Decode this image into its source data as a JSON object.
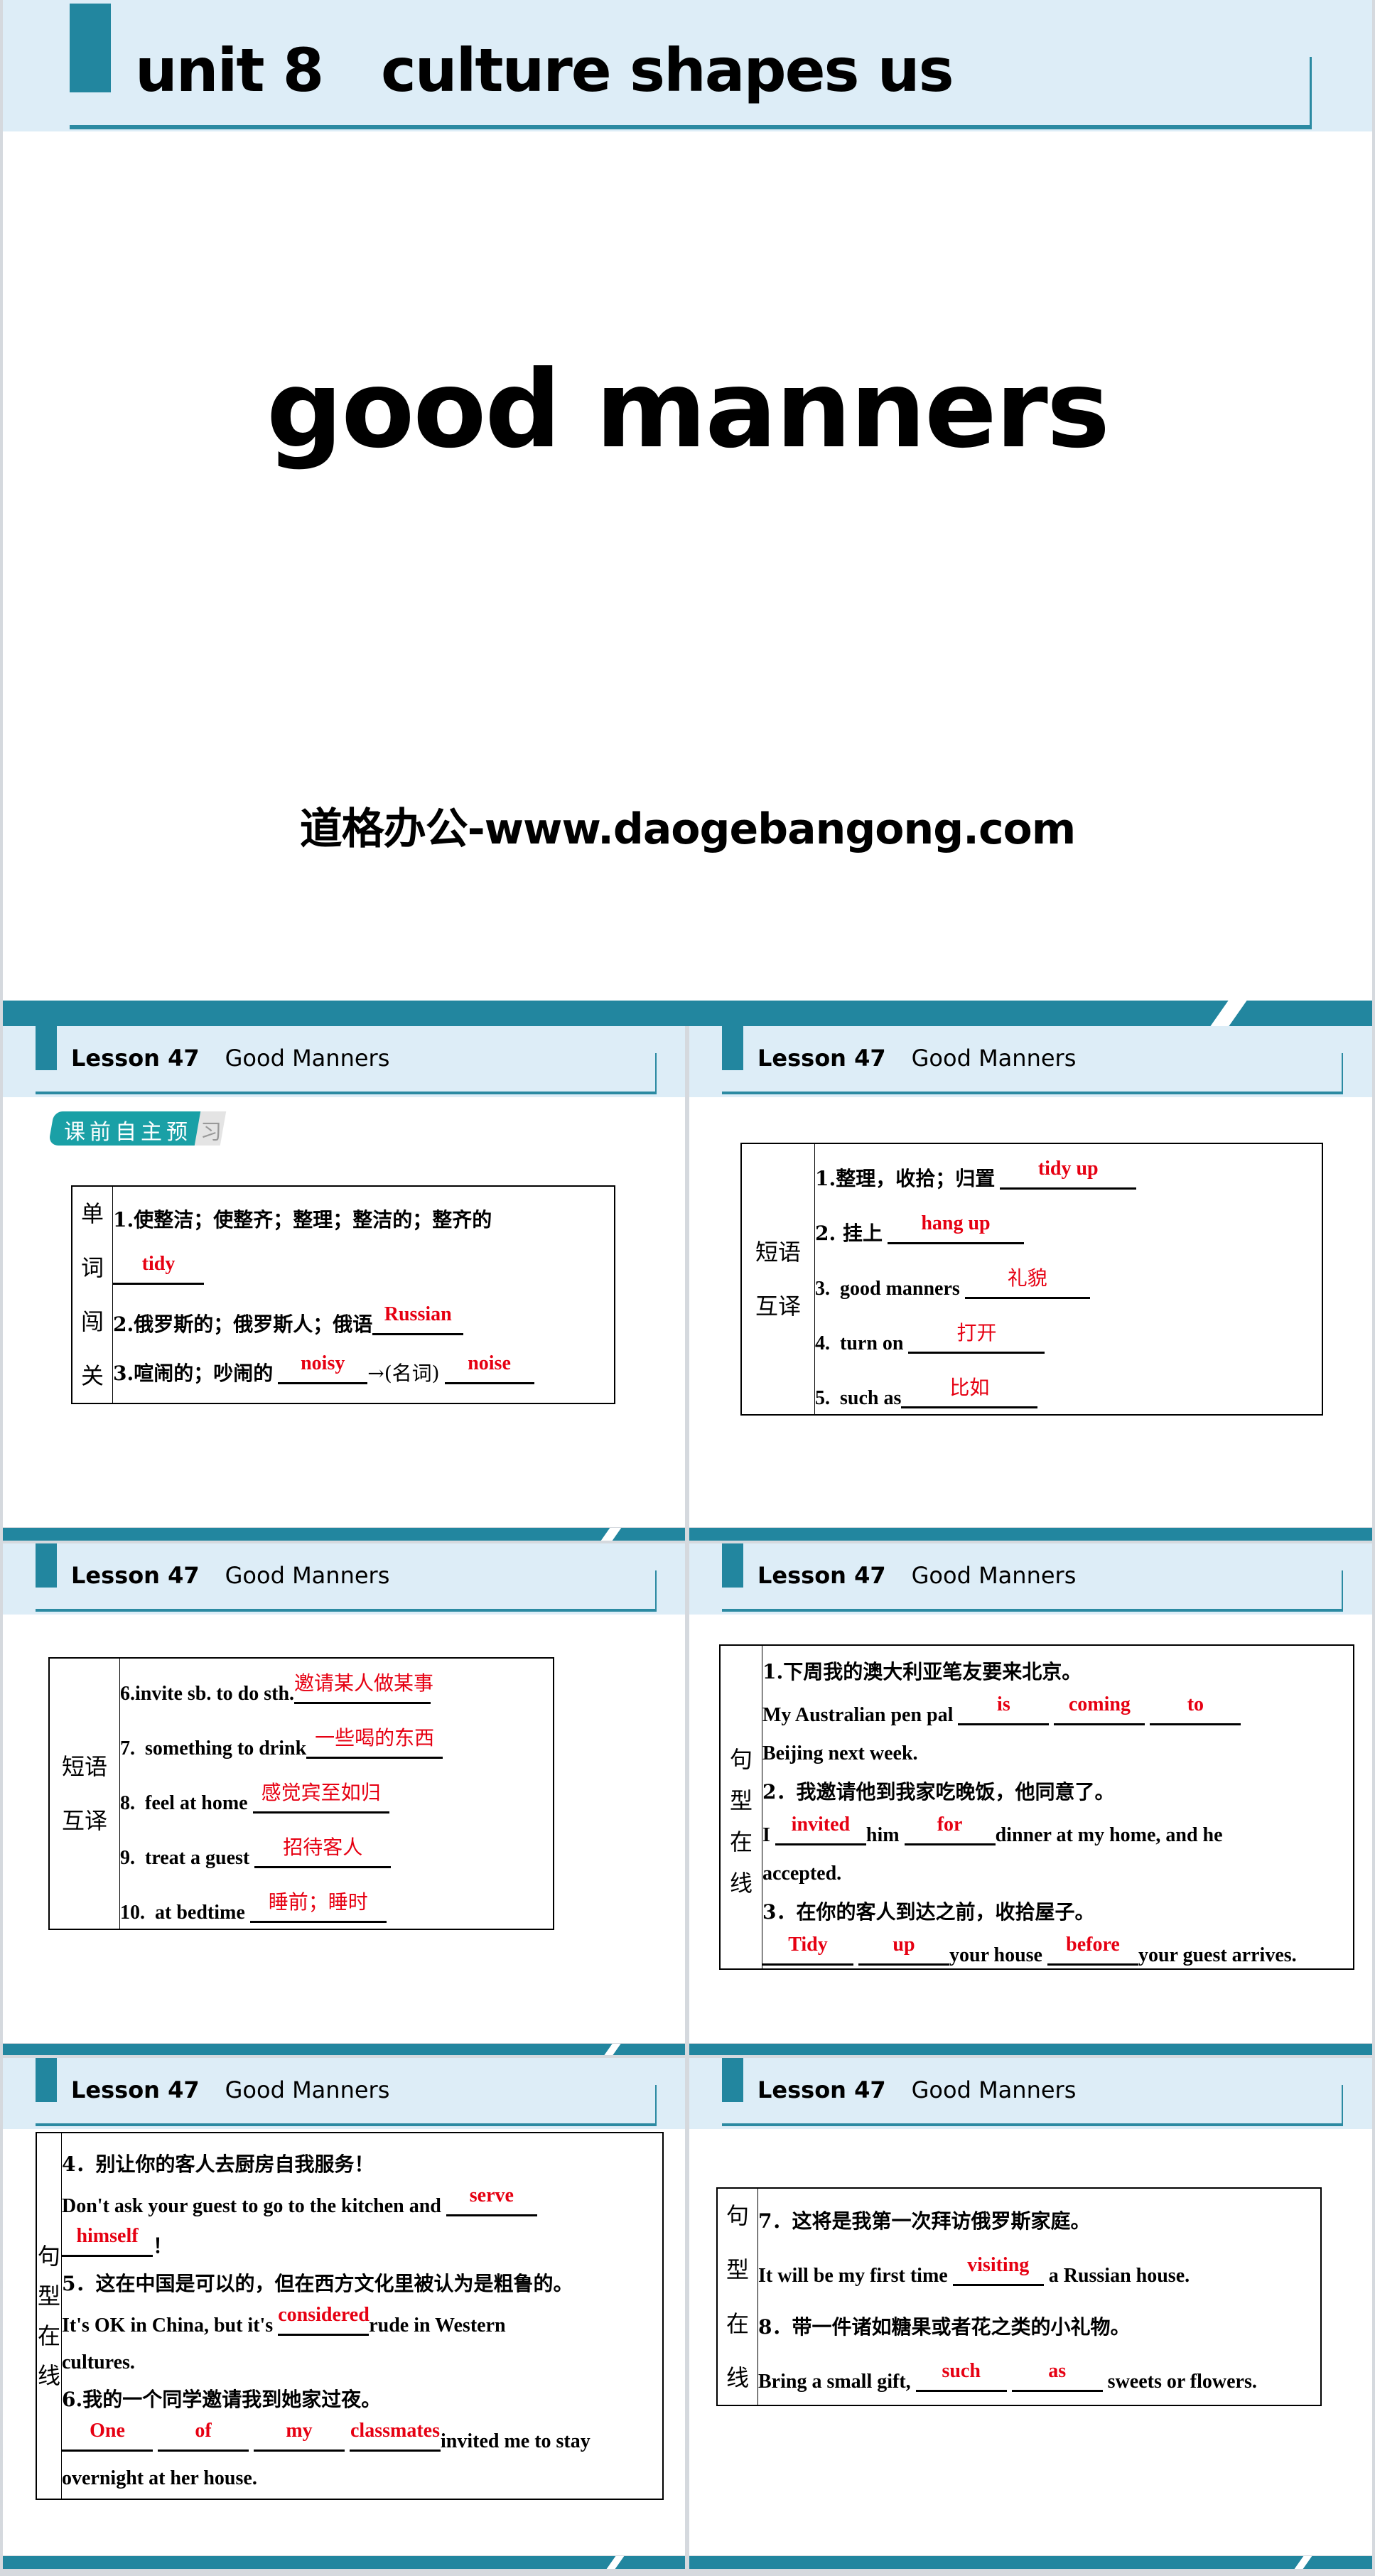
{
  "cover": {
    "unit_title": "unit 8   culture shapes us",
    "main_title": "good manners",
    "website": "道格办公-www.daogebangong.com"
  },
  "lesson_header": {
    "lesson": "Lesson 47",
    "title": "Good Manners"
  },
  "badge": {
    "text": "课前自主预",
    "last_char": "习"
  },
  "colors": {
    "accent": "#22869f",
    "header_band": "#ddedf7",
    "answer": "#e60012"
  },
  "slide2": {
    "side_label": [
      "单",
      "词",
      "闯",
      "关"
    ],
    "items": [
      {
        "prompt": "1.使整洁；使整齐；整理；整洁的；整齐的",
        "answer": "tidy"
      },
      {
        "prompt": "2.俄罗斯的；俄罗斯人；俄语",
        "answer": "Russian"
      },
      {
        "prompt": "3.喧闹的；吵闹的",
        "answer": "noisy",
        "mid": "→(名词)",
        "answer2": "noise"
      }
    ]
  },
  "slide3": {
    "side_label": [
      "短语",
      "互译"
    ],
    "items": [
      {
        "prompt": "1.整理，收拾；归置",
        "answer": "tidy up"
      },
      {
        "prompt": "2. 挂上",
        "answer": "hang up"
      },
      {
        "prompt": "3.  good manners",
        "answer": "礼貌"
      },
      {
        "prompt": "4.  turn on",
        "answer": "打开"
      },
      {
        "prompt": "5.  such as",
        "answer": "比如"
      }
    ]
  },
  "slide4": {
    "side_label": [
      "短语",
      "互译"
    ],
    "items": [
      {
        "prompt": "6.invite sb. to do sth.",
        "answer": "邀请某人做某事"
      },
      {
        "prompt": "7.  something to drink",
        "answer": "一些喝的东西"
      },
      {
        "prompt": "8.  feel at home",
        "answer": "感觉宾至如归"
      },
      {
        "prompt": "9.  treat a guest",
        "answer": "招待客人"
      },
      {
        "prompt": "10.  at bedtime",
        "answer": "睡前；睡时"
      }
    ]
  },
  "slide5": {
    "side_label": [
      "句",
      "型",
      "在",
      "线"
    ],
    "s1_zh": "1.下周我的澳大利亚笔友要来北京。",
    "s1_en_a": "My Australian pen pal ",
    "s1_answers": [
      "is",
      "coming",
      "to"
    ],
    "s1_en_b": "Beijing next week.",
    "s2_zh": "2．我邀请他到我家吃晚饭，他同意了。",
    "s2_en_a": "I ",
    "s2_answer1": "invited",
    "s2_en_b": "him ",
    "s2_answer2": "for",
    "s2_en_c": "dinner at my home, and he",
    "s2_en_d": "accepted.",
    "s3_zh": "3．在你的客人到达之前，收拾屋子。",
    "s3_answers": [
      "Tidy",
      "up"
    ],
    "s3_en_a": "your house ",
    "s3_answer3": "before",
    "s3_en_b": "your guest arrives."
  },
  "slide6": {
    "side_label": [
      "句",
      "型",
      "在",
      "线"
    ],
    "s4_zh": "4．别让你的客人去厨房自我服务！",
    "s4_en_a": "Don't ask your guest to go to the kitchen and ",
    "s4_answer1": "serve",
    "s4_answer2": "himself",
    "s4_end": "！",
    "s5_zh": "5．这在中国是可以的，但在西方文化里被认为是粗鲁的。",
    "s5_en_a": "It's OK in China, but it's ",
    "s5_answer": "considered",
    "s5_en_b": "rude in Western",
    "s5_en_c": "cultures.",
    "s6_zh": "6.我的一个同学邀请我到她家过夜。",
    "s6_answers": [
      "One",
      "of",
      "my",
      "classmates"
    ],
    "s6_en_a": "invited me to stay",
    "s6_en_b": "overnight at her house."
  },
  "slide7": {
    "side_label": [
      "句",
      "型",
      "在",
      "线"
    ],
    "s7_zh": "7．这将是我第一次拜访俄罗斯家庭。",
    "s7_en_a": "It will be my first time ",
    "s7_answer": "visiting",
    "s7_en_b": " a Russian house.",
    "s8_zh": "8．带一件诸如糖果或者花之类的小礼物。",
    "s8_en_a": "Bring a small gift, ",
    "s8_answers": [
      "such",
      "as"
    ],
    "s8_en_b": " sweets or flowers."
  }
}
